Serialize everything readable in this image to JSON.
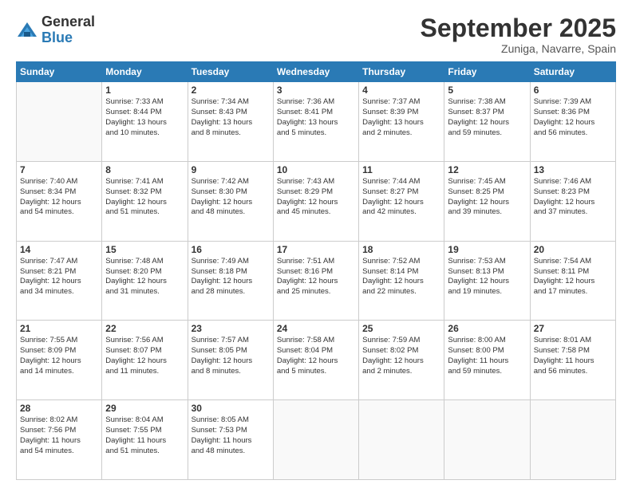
{
  "logo": {
    "general": "General",
    "blue": "Blue"
  },
  "header": {
    "month": "September 2025",
    "location": "Zuniga, Navarre, Spain"
  },
  "days_of_week": [
    "Sunday",
    "Monday",
    "Tuesday",
    "Wednesday",
    "Thursday",
    "Friday",
    "Saturday"
  ],
  "weeks": [
    [
      {
        "day": "",
        "info": ""
      },
      {
        "day": "1",
        "info": "Sunrise: 7:33 AM\nSunset: 8:44 PM\nDaylight: 13 hours\nand 10 minutes."
      },
      {
        "day": "2",
        "info": "Sunrise: 7:34 AM\nSunset: 8:43 PM\nDaylight: 13 hours\nand 8 minutes."
      },
      {
        "day": "3",
        "info": "Sunrise: 7:36 AM\nSunset: 8:41 PM\nDaylight: 13 hours\nand 5 minutes."
      },
      {
        "day": "4",
        "info": "Sunrise: 7:37 AM\nSunset: 8:39 PM\nDaylight: 13 hours\nand 2 minutes."
      },
      {
        "day": "5",
        "info": "Sunrise: 7:38 AM\nSunset: 8:37 PM\nDaylight: 12 hours\nand 59 minutes."
      },
      {
        "day": "6",
        "info": "Sunrise: 7:39 AM\nSunset: 8:36 PM\nDaylight: 12 hours\nand 56 minutes."
      }
    ],
    [
      {
        "day": "7",
        "info": "Sunrise: 7:40 AM\nSunset: 8:34 PM\nDaylight: 12 hours\nand 54 minutes."
      },
      {
        "day": "8",
        "info": "Sunrise: 7:41 AM\nSunset: 8:32 PM\nDaylight: 12 hours\nand 51 minutes."
      },
      {
        "day": "9",
        "info": "Sunrise: 7:42 AM\nSunset: 8:30 PM\nDaylight: 12 hours\nand 48 minutes."
      },
      {
        "day": "10",
        "info": "Sunrise: 7:43 AM\nSunset: 8:29 PM\nDaylight: 12 hours\nand 45 minutes."
      },
      {
        "day": "11",
        "info": "Sunrise: 7:44 AM\nSunset: 8:27 PM\nDaylight: 12 hours\nand 42 minutes."
      },
      {
        "day": "12",
        "info": "Sunrise: 7:45 AM\nSunset: 8:25 PM\nDaylight: 12 hours\nand 39 minutes."
      },
      {
        "day": "13",
        "info": "Sunrise: 7:46 AM\nSunset: 8:23 PM\nDaylight: 12 hours\nand 37 minutes."
      }
    ],
    [
      {
        "day": "14",
        "info": "Sunrise: 7:47 AM\nSunset: 8:21 PM\nDaylight: 12 hours\nand 34 minutes."
      },
      {
        "day": "15",
        "info": "Sunrise: 7:48 AM\nSunset: 8:20 PM\nDaylight: 12 hours\nand 31 minutes."
      },
      {
        "day": "16",
        "info": "Sunrise: 7:49 AM\nSunset: 8:18 PM\nDaylight: 12 hours\nand 28 minutes."
      },
      {
        "day": "17",
        "info": "Sunrise: 7:51 AM\nSunset: 8:16 PM\nDaylight: 12 hours\nand 25 minutes."
      },
      {
        "day": "18",
        "info": "Sunrise: 7:52 AM\nSunset: 8:14 PM\nDaylight: 12 hours\nand 22 minutes."
      },
      {
        "day": "19",
        "info": "Sunrise: 7:53 AM\nSunset: 8:13 PM\nDaylight: 12 hours\nand 19 minutes."
      },
      {
        "day": "20",
        "info": "Sunrise: 7:54 AM\nSunset: 8:11 PM\nDaylight: 12 hours\nand 17 minutes."
      }
    ],
    [
      {
        "day": "21",
        "info": "Sunrise: 7:55 AM\nSunset: 8:09 PM\nDaylight: 12 hours\nand 14 minutes."
      },
      {
        "day": "22",
        "info": "Sunrise: 7:56 AM\nSunset: 8:07 PM\nDaylight: 12 hours\nand 11 minutes."
      },
      {
        "day": "23",
        "info": "Sunrise: 7:57 AM\nSunset: 8:05 PM\nDaylight: 12 hours\nand 8 minutes."
      },
      {
        "day": "24",
        "info": "Sunrise: 7:58 AM\nSunset: 8:04 PM\nDaylight: 12 hours\nand 5 minutes."
      },
      {
        "day": "25",
        "info": "Sunrise: 7:59 AM\nSunset: 8:02 PM\nDaylight: 12 hours\nand 2 minutes."
      },
      {
        "day": "26",
        "info": "Sunrise: 8:00 AM\nSunset: 8:00 PM\nDaylight: 11 hours\nand 59 minutes."
      },
      {
        "day": "27",
        "info": "Sunrise: 8:01 AM\nSunset: 7:58 PM\nDaylight: 11 hours\nand 56 minutes."
      }
    ],
    [
      {
        "day": "28",
        "info": "Sunrise: 8:02 AM\nSunset: 7:56 PM\nDaylight: 11 hours\nand 54 minutes."
      },
      {
        "day": "29",
        "info": "Sunrise: 8:04 AM\nSunset: 7:55 PM\nDaylight: 11 hours\nand 51 minutes."
      },
      {
        "day": "30",
        "info": "Sunrise: 8:05 AM\nSunset: 7:53 PM\nDaylight: 11 hours\nand 48 minutes."
      },
      {
        "day": "",
        "info": ""
      },
      {
        "day": "",
        "info": ""
      },
      {
        "day": "",
        "info": ""
      },
      {
        "day": "",
        "info": ""
      }
    ]
  ]
}
